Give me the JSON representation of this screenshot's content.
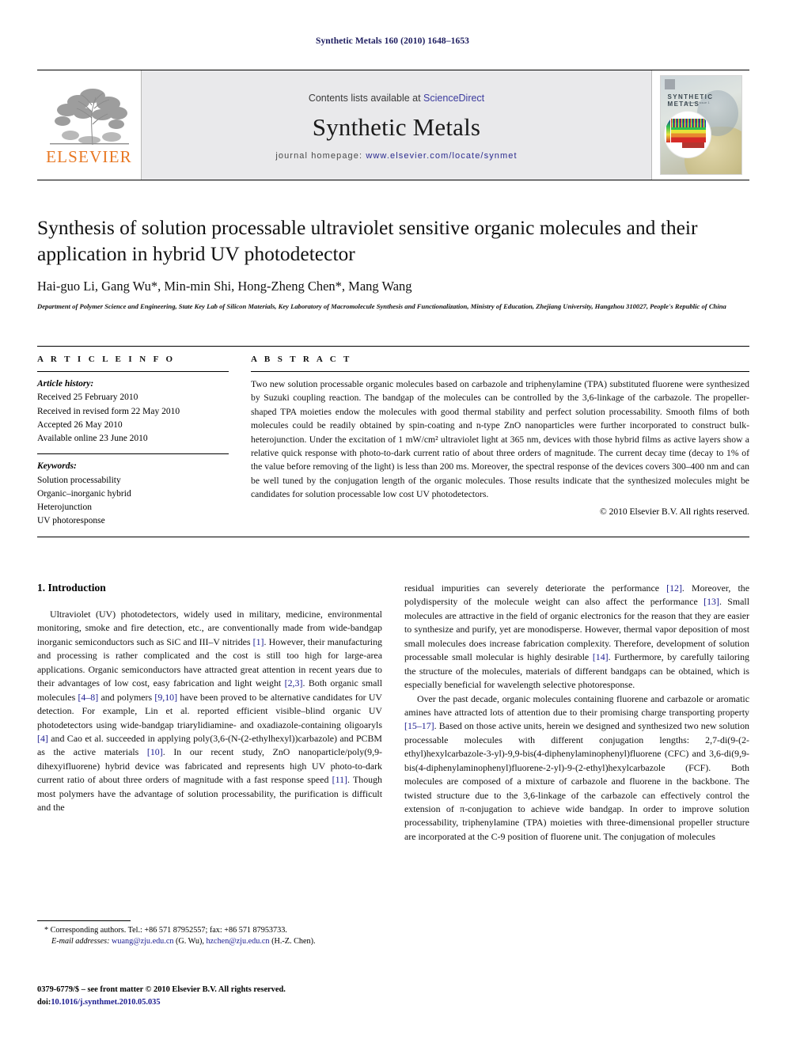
{
  "running_head": "Synthetic Metals 160 (2010) 1648–1653",
  "masthead": {
    "contents_prefix": "Contents lists available at ",
    "sciencedirect": "ScienceDirect",
    "journal_name": "Synthetic Metals",
    "homepage_prefix": "journal homepage:",
    "homepage_url": "www.elsevier.com/locate/synmet",
    "publisher_word": "ELSEVIER",
    "cover_title": "SYNTHETIC METALS",
    "cover_subtitle": "Volume 1 Issue 1"
  },
  "article": {
    "title": "Synthesis of solution processable ultraviolet sensitive organic molecules and their application in hybrid UV photodetector",
    "authors": "Hai-guo Li, Gang Wu*, Min-min Shi, Hong-Zheng Chen*, Mang Wang",
    "affiliation": "Department of Polymer Science and Engineering, State Key Lab of Silicon Materials, Key Laboratory of Macromolecule Synthesis and Functionalization, Ministry of Education, Zhejiang University, Hangzhou 310027, People's Republic of China"
  },
  "article_info": {
    "heading": "A R T I C L E  I N F O",
    "history_label": "Article history:",
    "history": [
      "Received 25 February 2010",
      "Received in revised form 22 May 2010",
      "Accepted 26 May 2010",
      "Available online 23 June 2010"
    ],
    "keywords_label": "Keywords:",
    "keywords": [
      "Solution processability",
      "Organic–inorganic hybrid",
      "Heterojunction",
      "UV photoresponse"
    ]
  },
  "abstract": {
    "heading": "A B S T R A C T",
    "text": "Two new solution processable organic molecules based on carbazole and triphenylamine (TPA) substituted fluorene were synthesized by Suzuki coupling reaction. The bandgap of the molecules can be controlled by the 3,6-linkage of the carbazole. The propeller-shaped TPA moieties endow the molecules with good thermal stability and perfect solution processability. Smooth films of both molecules could be readily obtained by spin-coating and n-type ZnO nanoparticles were further incorporated to construct bulk-heterojunction. Under the excitation of 1 mW/cm² ultraviolet light at 365 nm, devices with those hybrid films as active layers show a relative quick response with photo-to-dark current ratio of about three orders of magnitude. The current decay time (decay to 1% of the value before removing of the light) is less than 200 ms. Moreover, the spectral response of the devices covers 300–400 nm and can be well tuned by the conjugation length of the organic molecules. Those results indicate that the synthesized molecules might be candidates for solution processable low cost UV photodetectors.",
    "copyright": "© 2010 Elsevier B.V. All rights reserved."
  },
  "body": {
    "section_title": "1. Introduction",
    "left_paragraph_1_a": "Ultraviolet (UV) photodetectors, widely used in military, medicine, environmental monitoring, smoke and fire detection, etc., are conventionally made from wide-bandgap inorganic semiconductors such as SiC and III–V nitrides ",
    "cite_1": "[1]",
    "left_paragraph_1_b": ". However, their manufacturing and processing is rather complicated and the cost is still too high for large-area applications. Organic semiconductors have attracted great attention in recent years due to their advantages of low cost, easy fabrication and light weight ",
    "cite_23": "[2,3]",
    "left_paragraph_1_c": ". Both organic small molecules ",
    "cite_48": "[4–8]",
    "left_paragraph_1_d": " and polymers ",
    "cite_910": "[9,10]",
    "left_paragraph_1_e": " have been proved to be alternative candidates for UV detection. For example, Lin et al. reported efficient visible–blind organic UV photodetectors using wide-bandgap triarylidiamine- and oxadiazole-containing oligoaryls ",
    "cite_4": "[4]",
    "left_paragraph_1_f": " and Cao et al. succeeded in applying poly(3,6-(N-(2-ethylhexyl))carbazole) and PCBM as the active materials ",
    "cite_10": "[10]",
    "left_paragraph_1_g": ". In our recent study, ZnO nanoparticle/poly(9,9-dihexyifluorene) hybrid device was fabricated and represents high UV photo-to-dark current ratio of about three orders of magnitude with a fast response speed ",
    "cite_11": "[11]",
    "left_paragraph_1_h": ". Though most polymers have the advantage of solution processability, the purification is difficult and the",
    "right_paragraph_1_a": "residual impurities can severely deteriorate the performance ",
    "cite_12": "[12]",
    "right_paragraph_1_b": ". Moreover, the polydispersity of the molecule weight can also affect the performance ",
    "cite_13": "[13]",
    "right_paragraph_1_c": ". Small molecules are attractive in the field of organic electronics for the reason that they are easier to synthesize and purify, yet are monodisperse. However, thermal vapor deposition of most small molecules does increase fabrication complexity. Therefore, development of solution processable small molecular is highly desirable ",
    "cite_14": "[14]",
    "right_paragraph_1_d": ". Furthermore, by carefully tailoring the structure of the molecules, materials of different bandgaps can be obtained, which is especially beneficial for wavelength selective photoresponse.",
    "right_paragraph_2_a": "Over the past decade, organic molecules containing fluorene and carbazole or aromatic amines have attracted lots of attention due to their promising charge transporting property ",
    "cite_1517": "[15–17]",
    "right_paragraph_2_b": ". Based on those active units, herein we designed and synthesized two new solution processable molecules with different conjugation lengths: 2,7-di(9-(2-ethyl)hexylcarbazole-3-yl)-9,9-bis(4-diphenylaminophenyl)fluorene (CFC) and 3,6-di(9,9-bis(4-diphenylaminophenyl)fluorene-2-yl)-9-(2-ethyl)hexylcarbazole (FCF). Both molecules are composed of a mixture of carbazole and fluorene in the backbone. The twisted structure due to the 3,6-linkage of the carbazole can effectively control the extension of π-conjugation to achieve wide bandgap. In order to improve solution processability, triphenylamine (TPA) moieties with three-dimensional propeller structure are incorporated at the C-9 position of fluorene unit. The conjugation of molecules"
  },
  "footnote": {
    "corresponding": "* Corresponding authors. Tel.: +86 571 87952557; fax: +86 571 87953733.",
    "email_label": "E-mail addresses:",
    "email_1": "wuang@zju.edu.cn",
    "email_1_owner": " (G. Wu), ",
    "email_2": "hzchen@zju.edu.cn",
    "email_2_owner": " (H.-Z. Chen)."
  },
  "issn": {
    "line1": "0379-6779/$ – see front matter © 2010 Elsevier B.V. All rights reserved.",
    "doi_label": "doi:",
    "doi_value": "10.1016/j.synthmet.2010.05.035"
  }
}
